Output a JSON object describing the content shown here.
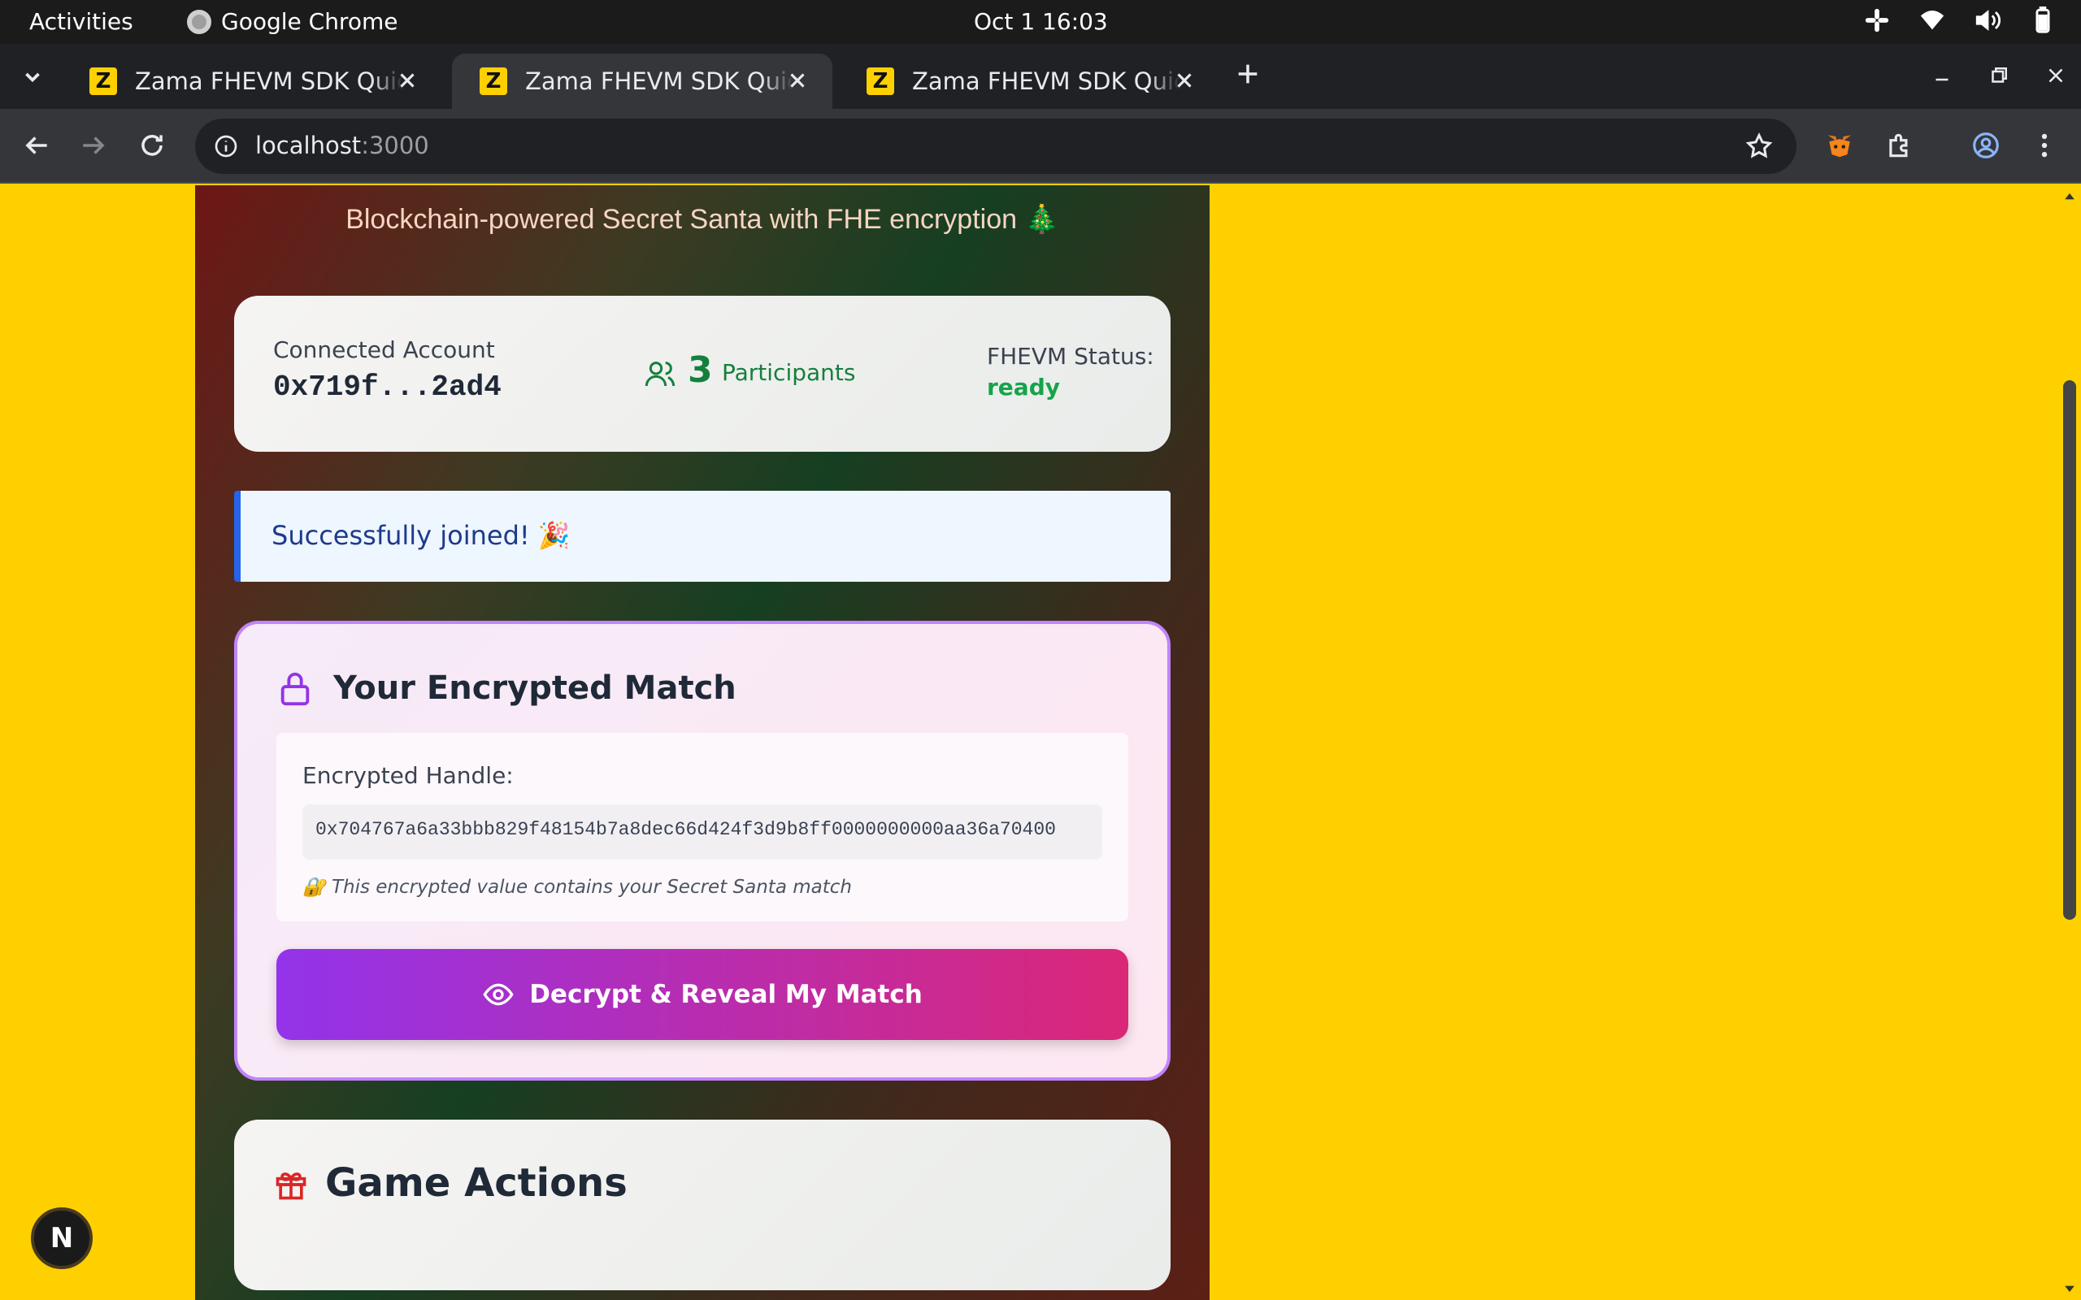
{
  "system_bar": {
    "activities": "Activities",
    "app_name": "Google Chrome",
    "clock": "Oct 1  16:03"
  },
  "browser": {
    "tabs": [
      {
        "title": "Zama FHEVM SDK Quickstart",
        "active": false,
        "favicon": "Z"
      },
      {
        "title": "Zama FHEVM SDK Quickstart",
        "active": true,
        "favicon": "Z"
      },
      {
        "title": "Zama FHEVM SDK Quickstart",
        "active": false,
        "favicon": "Z"
      }
    ],
    "url_host": "localhost",
    "url_port": ":3000"
  },
  "page": {
    "subtitle": "Blockchain-powered Secret Santa with FHE encryption 🎄",
    "stats": {
      "account_label": "Connected Account",
      "account_value": "0x719f...2ad4",
      "participant_count": "3",
      "participant_label": "Participants",
      "fhevm_label": "FHEVM Status:",
      "fhevm_value": "ready"
    },
    "alert": "Successfully joined! 🎉",
    "match": {
      "heading": "Your Encrypted Match",
      "handle_label": "Encrypted Handle:",
      "handle_value": "0x704767a6a33bbb829f48154b7a8dec66d424f3d9b8ff0000000000aa36a70400",
      "note": "🔐 This encrypted value contains your Secret Santa match",
      "button": "Decrypt & Reveal My Match"
    },
    "actions": {
      "heading": "Game Actions"
    }
  },
  "overlay": {
    "badge_letter": "N"
  },
  "colors": {
    "page_background": "#ffd000",
    "accent_purple": "#9333ea",
    "accent_pink": "#db2777",
    "status_green": "#16a34a",
    "alert_blue": "#2563eb"
  }
}
